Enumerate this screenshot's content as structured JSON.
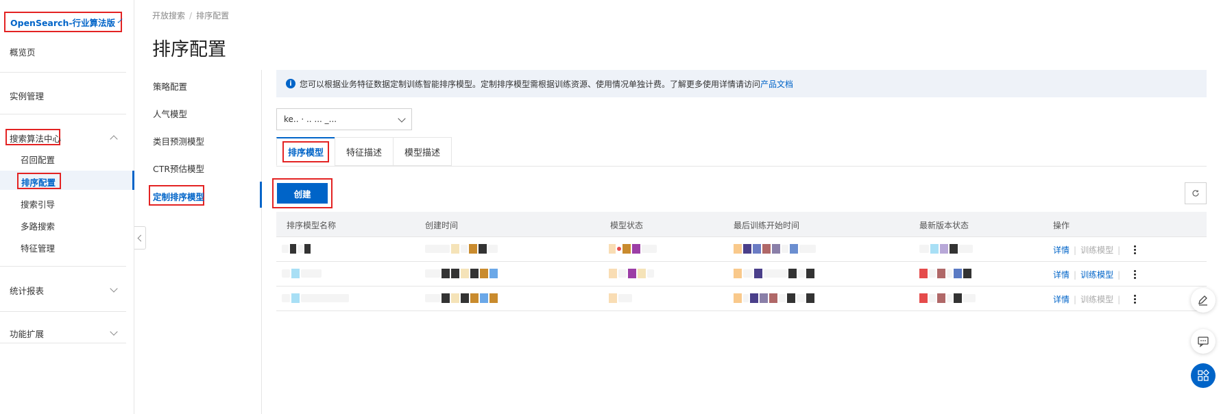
{
  "sidebar": {
    "product": "OpenSearch-行业算法版",
    "overview": "概览页",
    "instance_mgmt": "实例管理",
    "search_center": "搜索算法中心",
    "sub_items": [
      "召回配置",
      "排序配置",
      "搜索引导",
      "多路搜索",
      "特征管理"
    ],
    "stats": "统计报表",
    "extensions": "功能扩展"
  },
  "header": {
    "breadcrumb_root": "开放搜索",
    "breadcrumb_sep": "/",
    "breadcrumb_current": "排序配置",
    "title": "排序配置"
  },
  "subnav": {
    "items": [
      "策略配置",
      "人气模型",
      "类目预测模型",
      "CTR预估模型",
      "定制排序模型"
    ]
  },
  "notice": {
    "text": "您可以根据业务特征数据定制训练智能排序模型。定制排序模型需根据训练资源、使用情况单独计费。了解更多使用详情请访问",
    "link": "产品文档"
  },
  "select": {
    "value": "ke.. · .. ... _..."
  },
  "tabs": [
    "排序模型",
    "特征描述",
    "模型描述"
  ],
  "toolbar": {
    "create": "创建",
    "refresh_icon": "refresh-icon"
  },
  "table": {
    "headers": [
      "排序模型名称",
      "创建时间",
      "模型状态",
      "最后训练开始时间",
      "最新版本状态",
      "操作"
    ],
    "rows": [
      {
        "action_detail": "详情",
        "action_train": "训练模型",
        "train_enabled": false
      },
      {
        "action_detail": "详情",
        "action_train": "训练模型",
        "train_enabled": true
      },
      {
        "action_detail": "详情",
        "action_train": "训练模型",
        "train_enabled": false
      }
    ]
  },
  "colors": {
    "accent": "#0064c8",
    "highlight_box": "#e32222"
  }
}
